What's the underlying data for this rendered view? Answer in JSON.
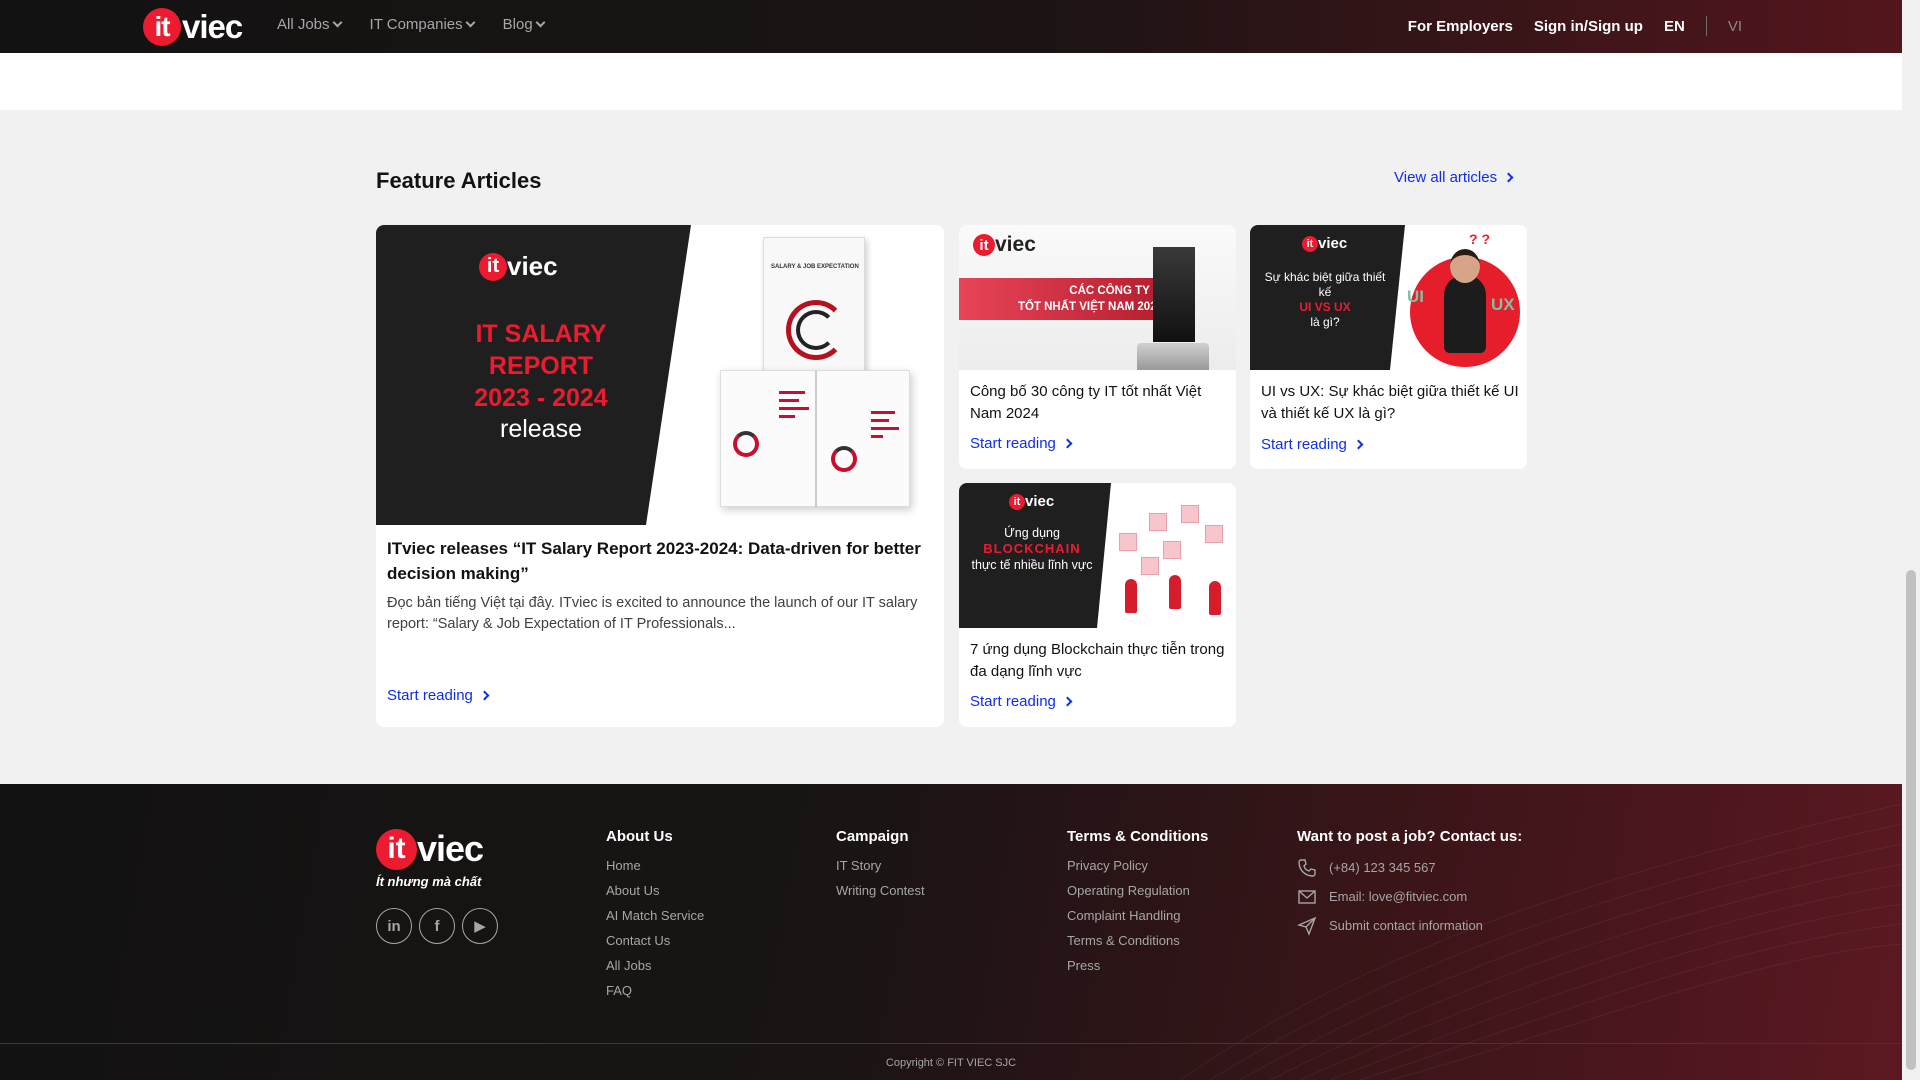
{
  "navbar": {
    "logo_mark": "it",
    "logo_text": "viec",
    "menu": [
      {
        "label": "All Jobs"
      },
      {
        "label": "IT Companies"
      },
      {
        "label": "Blog"
      }
    ],
    "for_employers": "For Employers",
    "sign_in": "Sign in/Sign up",
    "lang_en": "EN",
    "lang_vi": "VI"
  },
  "section": {
    "title": "Feature Articles",
    "view_all": "View all articles"
  },
  "articles": [
    {
      "title": "ITviec releases “IT Salary Report 2023-2024: Data-driven for better decision making”",
      "description": "Đọc bản tiếng Việt tại đây. ITviec is excited to announce the launch of our IT salary report: “Salary & Job Expectation of IT Professionals...",
      "cta": "Start reading",
      "image": {
        "logo_mark": "it",
        "logo_text": "viec",
        "headline_1": "IT SALARY",
        "headline_2": "REPORT",
        "headline_3": "2023 - 2024",
        "headline_4": "release",
        "booklet_label": "SALARY & JOB EXPECTATION"
      }
    },
    {
      "title": "Công bố 30 công ty IT tốt nhất Việt Nam 2024",
      "cta": "Start reading",
      "image": {
        "logo_mark": "it",
        "logo_text": "viec",
        "banner_1": "CÁC CÔNG TY IT",
        "banner_2": "TỐT NHẤT VIỆT NAM 2024"
      }
    },
    {
      "title": "UI vs UX: Sự khác biệt giữa thiết kế UI và thiết kế UX là gì?",
      "cta": "Start reading",
      "image": {
        "logo_mark": "it",
        "logo_text": "viec",
        "text_1": "Sự khác biệt giữa thiết kế",
        "text_hl": "UI VS UX",
        "text_2": "là gì?",
        "ui": "UI",
        "ux": "UX",
        "q": "? ?"
      }
    },
    {
      "title": "7 ứng dụng Blockchain thực tiễn trong đa dạng lĩnh vực",
      "cta": "Start reading",
      "image": {
        "logo_mark": "it",
        "logo_text": "viec",
        "text_1": "Ứng dụng",
        "text_hl": "BLOCKCHAIN",
        "text_2": "thực tế nhiều lĩnh vực"
      }
    }
  ],
  "footer": {
    "logo_mark": "it",
    "logo_text": "viec",
    "tagline": "Ít nhưng mà chất",
    "socials": [
      "in",
      "f",
      "▶"
    ],
    "columns": [
      {
        "title": "About Us",
        "links": [
          "Home",
          "About Us",
          "AI Match Service",
          "Contact Us",
          "All Jobs",
          "FAQ"
        ]
      },
      {
        "title": "Campaign",
        "links": [
          "IT Story",
          "Writing Contest"
        ]
      },
      {
        "title": "Terms & Conditions",
        "links": [
          "Privacy Policy",
          "Operating Regulation",
          "Complaint Handling",
          "Terms & Conditions",
          "Press"
        ]
      }
    ],
    "contact": {
      "title": "Want to post a job? Contact us:",
      "phone": "(+84) 123 345 567",
      "email": "Email: love@fitviec.com",
      "submit": "Submit contact information"
    },
    "copyright": "Copyright © FIT VIEC SJC"
  },
  "colors": {
    "brand_red": "#ed1b2f",
    "link_blue": "#0e2eed",
    "dark": "#121212"
  }
}
